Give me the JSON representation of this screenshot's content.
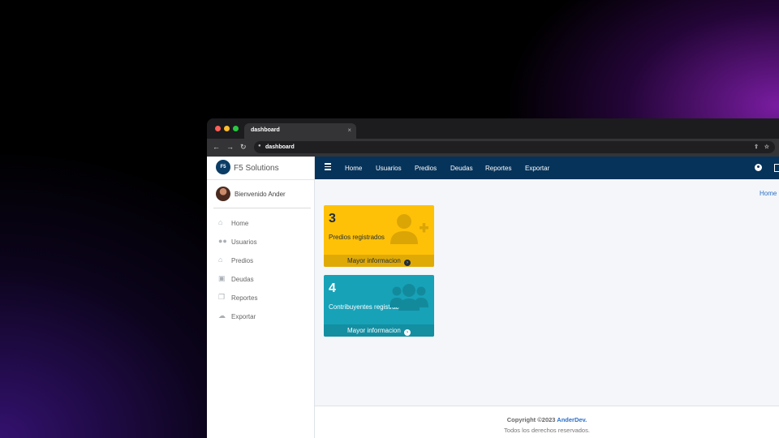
{
  "browser": {
    "tab_title": "dashboard",
    "tab_close": "×",
    "url": "dashboard",
    "back": "←",
    "forward": "→",
    "reload": "↻",
    "traffic_colors": [
      "#ff5f57",
      "#febc2e",
      "#28c840"
    ]
  },
  "sidebar": {
    "brand_logo": "F5",
    "brand": "F5 Solutions",
    "user_greeting": "Bienvenido Ander",
    "items": [
      {
        "label": "Home",
        "icon": "home-icon"
      },
      {
        "label": "Usuarios",
        "icon": "users-icon"
      },
      {
        "label": "Predios",
        "icon": "home-icon"
      },
      {
        "label": "Deudas",
        "icon": "money-icon"
      },
      {
        "label": "Reportes",
        "icon": "copy-icon"
      },
      {
        "label": "Exportar",
        "icon": "cloud-download-icon"
      }
    ]
  },
  "topnav": {
    "links": [
      "Home",
      "Usuarios",
      "Predios",
      "Deudas",
      "Reportes",
      "Exportar"
    ],
    "color": "#06335a"
  },
  "breadcrumb": "Home",
  "cards": [
    {
      "number": "3",
      "label": "Predios registrados",
      "link": "Mayor informacion",
      "color": "#ffc107",
      "icon": "user-plus-icon"
    },
    {
      "number": "4",
      "label": "Contribuyentes registrados",
      "link": "Mayor informacion",
      "color": "#17a2b8",
      "icon": "users-icon"
    }
  ],
  "footer": {
    "copyright": "Copyright ©2023",
    "author": "AnderDev.",
    "rights": "Todos los derechos reservados."
  }
}
